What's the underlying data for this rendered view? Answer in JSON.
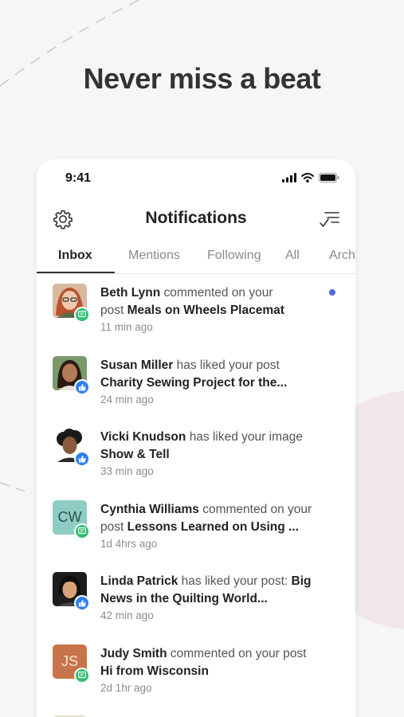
{
  "headline": "Never miss a beat",
  "statusbar": {
    "time": "9:41"
  },
  "navbar": {
    "title": "Notifications",
    "settings_icon": "gear-icon",
    "mark_read_icon": "checklist-icon"
  },
  "tabs": [
    {
      "label": "Inbox",
      "active": true
    },
    {
      "label": "Mentions",
      "active": false
    },
    {
      "label": "Following",
      "active": false
    },
    {
      "label": "All",
      "active": false
    },
    {
      "label": "Arch",
      "active": false
    }
  ],
  "notifications": [
    {
      "name": "Beth Lynn",
      "action": "commented on your",
      "prefix": "post",
      "target": "Meals on Wheels Placemat",
      "time": "11 min ago",
      "type": "comment",
      "unread": true,
      "avatar_initials": ""
    },
    {
      "name": "Susan Miller",
      "action": "has liked your post",
      "prefix": "",
      "target": "Charity Sewing Project for the...",
      "time": "24 min ago",
      "type": "like",
      "unread": false,
      "avatar_initials": ""
    },
    {
      "name": "Vicki Knudson",
      "action": "has liked your image",
      "prefix": "",
      "target": "Show & Tell",
      "time": "33 min ago",
      "type": "like",
      "unread": false,
      "avatar_initials": ""
    },
    {
      "name": "Cynthia Williams",
      "action": "commented on your",
      "prefix": "post",
      "target": "Lessons Learned on Using ...",
      "time": "1d 4hrs ago",
      "type": "comment",
      "unread": false,
      "avatar_initials": "CW"
    },
    {
      "name": "Linda Patrick",
      "action": "has liked your post:",
      "prefix": "",
      "target": "Big News in the Quilting World...",
      "time": "42 min ago",
      "type": "like",
      "unread": false,
      "avatar_initials": ""
    },
    {
      "name": "Judy Smith",
      "action": "commented on your post",
      "prefix": "",
      "target": "Hi from Wisconsin",
      "time": "2d 1hr ago",
      "type": "comment",
      "unread": false,
      "avatar_initials": "JS"
    }
  ],
  "colors": {
    "comment_badge": "#2ebf6e",
    "like_badge": "#2d82f0",
    "unread_dot": "#4d6bdc",
    "cw_avatar": "#8fcdc4",
    "js_avatar": "#c8744a"
  }
}
